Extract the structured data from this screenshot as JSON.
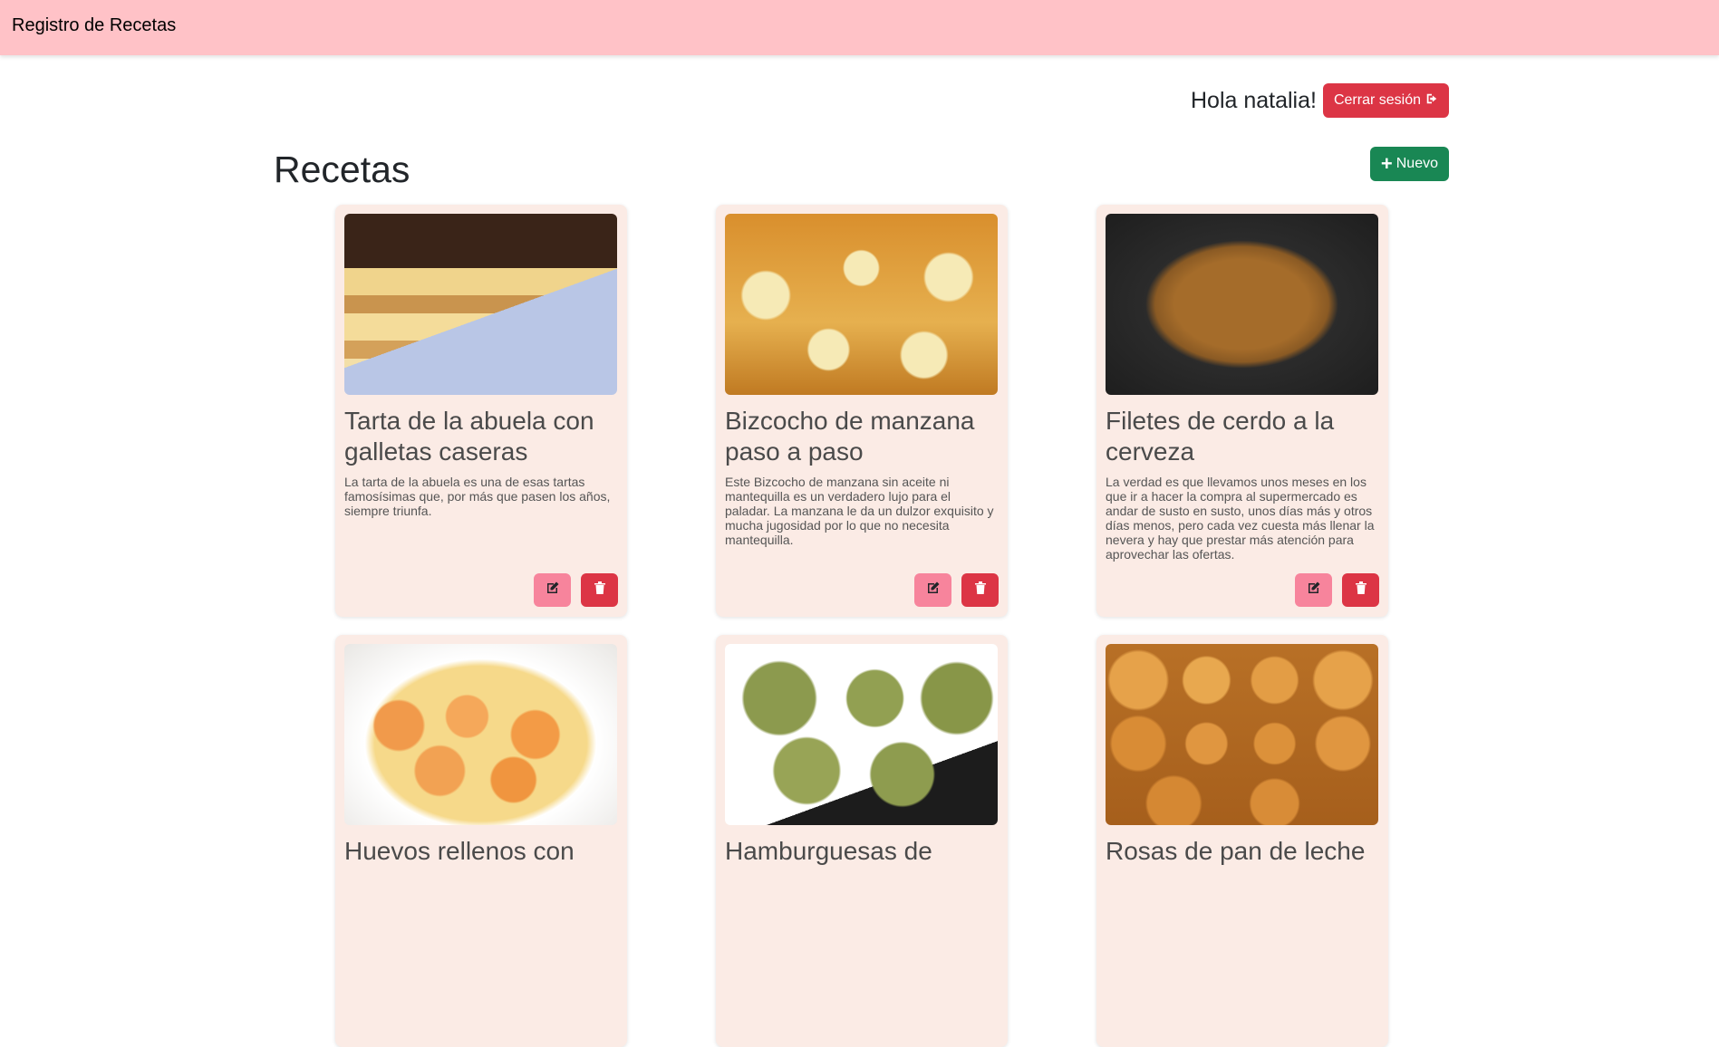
{
  "navbar": {
    "brand": "Registro de Recetas"
  },
  "user": {
    "greeting": "Hola natalia!",
    "logout_label": "Cerrar sesión",
    "logout_icon": "sign-out-icon"
  },
  "page": {
    "title": "Recetas",
    "new_button_label": "Nuevo",
    "new_button_icon": "plus-icon"
  },
  "colors": {
    "navbar_bg": "#ffc2c7",
    "card_bg": "#fbebe5",
    "danger": "#dc3545",
    "success": "#198754",
    "edit_pink": "#f7849c"
  },
  "recipes": [
    {
      "title": "Tarta de la abuela con galletas caseras",
      "description": "La tarta de la abuela es una de esas tartas famosísimas que, por más que pasen los años, siempre triunfa.",
      "image": "chocolate-layer-cake-image"
    },
    {
      "title": "Bizcocho de manzana paso a paso",
      "description": "Este Bizcocho de manzana sin aceite ni mantequilla es un verdadero lujo para el paladar. La manzana le da un dulzor exquisito y mucha jugosidad por lo que no necesita mantequilla.",
      "image": "apple-sponge-cake-image"
    },
    {
      "title": "Filetes de cerdo a la cerveza",
      "description": "La verdad es que llevamos unos meses en los que ir a hacer la compra al supermercado es andar de susto en susto, unos días más y otros días menos, pero cada vez cuesta más llenar la nevera y hay que prestar más atención para aprovechar las ofertas.",
      "image": "pork-fillets-in-pan-image"
    },
    {
      "title": "Huevos rellenos con",
      "description": "",
      "image": "stuffed-eggs-gratin-image"
    },
    {
      "title": "Hamburguesas de",
      "description": "",
      "image": "vegetable-burgers-image"
    },
    {
      "title": "Rosas de pan de leche",
      "description": "",
      "image": "milk-bread-rolls-image"
    }
  ],
  "card_actions": {
    "edit_icon": "edit-icon",
    "delete_icon": "trash-icon"
  }
}
